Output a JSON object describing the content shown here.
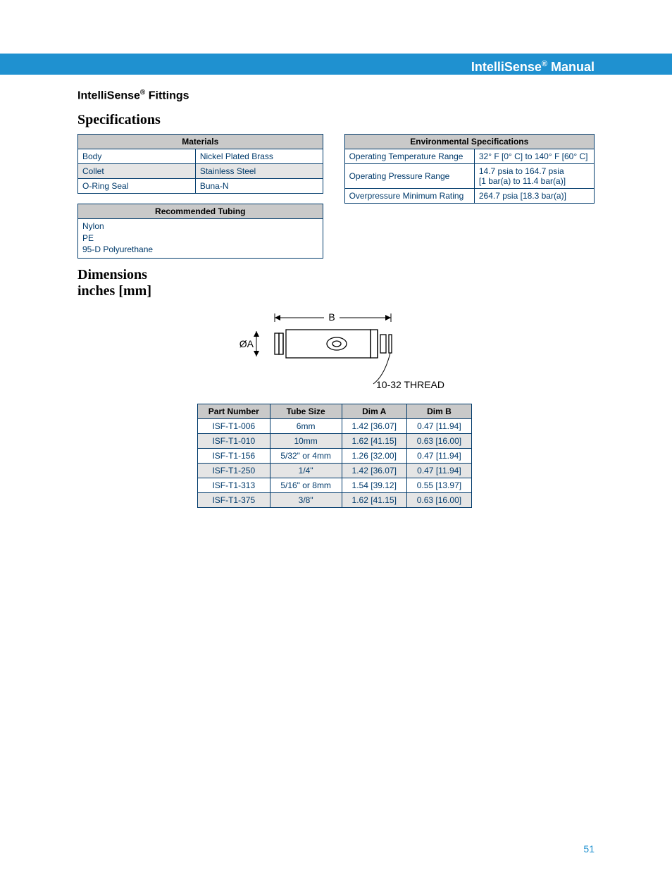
{
  "header": {
    "title_html": "IntelliSense<sup>®</sup> Manual"
  },
  "section": {
    "title_html": "IntelliSense<sup>®</sup> Fittings"
  },
  "spec_heading": "Specifications",
  "materials": {
    "heading": "Materials",
    "rows": [
      {
        "label": "Body",
        "value": "Nickel Plated Brass"
      },
      {
        "label": "Collet",
        "value": "Stainless Steel"
      },
      {
        "label": "O-Ring Seal",
        "value": "Buna-N"
      }
    ]
  },
  "recommended_tubing": {
    "heading": "Recommended Tubing",
    "items": [
      "Nylon",
      "PE",
      "95-D Polyurethane"
    ]
  },
  "env_specs": {
    "heading": "Environmental Specifications",
    "rows": [
      {
        "label": "Operating Temperature Range",
        "value": "32° F [0° C] to 140° F [60° C]"
      },
      {
        "label": "Operating Pressure Range",
        "value": "14.7 psia to 164.7 psia\n[1 bar(a) to 11.4 bar(a)]"
      },
      {
        "label": "Overpressure Minimum Rating",
        "value": "264.7 psia [18.3 bar(a)]"
      }
    ]
  },
  "dimensions": {
    "heading": "Dimensions",
    "subheading": "inches [mm]",
    "diagram": {
      "phi_label": "ØA",
      "b_label": "B",
      "thread_label": "10-32 THREAD"
    },
    "columns": [
      "Part Number",
      "Tube Size",
      "Dim A",
      "Dim B"
    ],
    "rows": [
      {
        "pn": "ISF-T1-006",
        "tube": "6mm",
        "a": "1.42 [36.07]",
        "b": "0.47 [11.94]"
      },
      {
        "pn": "ISF-T1-010",
        "tube": "10mm",
        "a": "1.62 [41.15]",
        "b": "0.63 [16.00]"
      },
      {
        "pn": "ISF-T1-156",
        "tube": "5/32\" or 4mm",
        "a": "1.26 [32.00]",
        "b": "0.47 [11.94]"
      },
      {
        "pn": "ISF-T1-250",
        "tube": "1/4\"",
        "a": "1.42 [36.07]",
        "b": "0.47 [11.94]"
      },
      {
        "pn": "ISF-T1-313",
        "tube": "5/16\" or 8mm",
        "a": "1.54 [39.12]",
        "b": "0.55 [13.97]"
      },
      {
        "pn": "ISF-T1-375",
        "tube": "3/8\"",
        "a": "1.62 [41.15]",
        "b": "0.63 [16.00]"
      }
    ]
  },
  "page_number": "51"
}
